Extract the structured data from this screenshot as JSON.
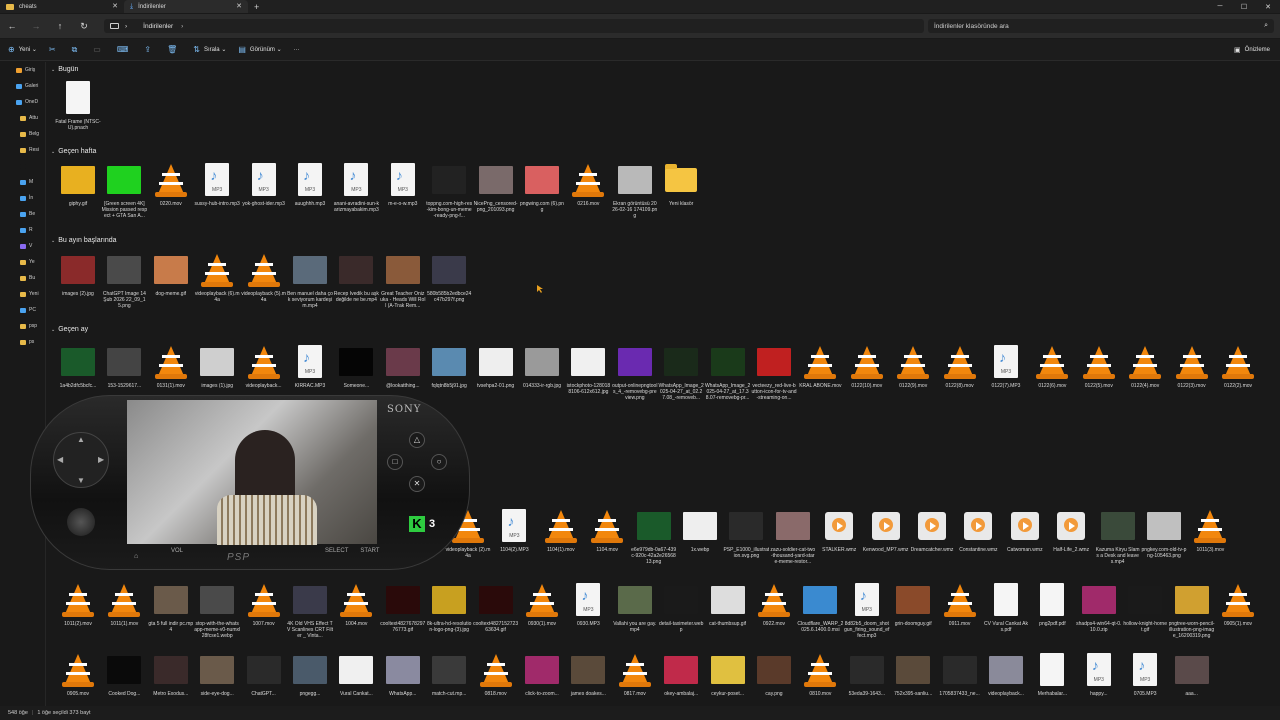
{
  "tabs": [
    {
      "label": "cheats",
      "active": false
    },
    {
      "label": "İndirilenler",
      "active": true
    }
  ],
  "address": {
    "path": [
      "İndirilenler"
    ],
    "search_placeholder": "İndirilenler klasöründe ara"
  },
  "commands": {
    "new": "Yeni",
    "sort": "Sırala",
    "view": "Görünüm",
    "more": "···",
    "preview": "Önizleme"
  },
  "sidebar": [
    {
      "label": "Giriş",
      "color": "#f0a030"
    },
    {
      "label": "Galeri",
      "color": "#4aa3f0"
    },
    {
      "label": "OneD",
      "color": "#4aa3f0"
    },
    {
      "label": "Attu",
      "color": "#e7b949"
    },
    {
      "label": "Belg",
      "color": "#e7b949"
    },
    {
      "label": "Resi",
      "color": "#e7b949"
    },
    {
      "label": "",
      "color": "#191919"
    },
    {
      "label": "M",
      "color": "#4aa3f0"
    },
    {
      "label": "İn",
      "color": "#4aa3f0"
    },
    {
      "label": "Be",
      "color": "#4aa3f0"
    },
    {
      "label": "R",
      "color": "#4aa3f0"
    },
    {
      "label": "V",
      "color": "#8a6af0"
    },
    {
      "label": "Ye",
      "color": "#e7b949"
    },
    {
      "label": "Bu",
      "color": "#e7b949"
    },
    {
      "label": "Yeni",
      "color": "#e7b949"
    },
    {
      "label": "PC",
      "color": "#4aa3f0"
    },
    {
      "label": "psp",
      "color": "#e7b949"
    },
    {
      "label": "ps",
      "color": "#e7b949"
    }
  ],
  "groups": {
    "today": "Bugün",
    "last_week": "Geçen hafta",
    "this_month": "Bu ayın başlarında",
    "last_month": "Geçen ay"
  },
  "rows": {
    "today": [
      {
        "name": "Fatal Frame (NTSC-U).pnach",
        "type": "blank"
      }
    ],
    "last_week": [
      {
        "name": "giphy.gif",
        "type": "thumb",
        "color": "#e8b020"
      },
      {
        "name": "[Green screen 4K] Mission passed respect + GTA San A...",
        "type": "thumb",
        "color": "#1fd11f"
      },
      {
        "name": "0220.mov",
        "type": "vlc"
      },
      {
        "name": "sussy-hub-intro.mp3",
        "type": "mp3"
      },
      {
        "name": "yok-ghost-ider.mp3",
        "type": "mp3"
      },
      {
        "name": "auughhh.mp3",
        "type": "mp3"
      },
      {
        "name": "anani-avradini-sun-karizmayabakim.mp3",
        "type": "mp3"
      },
      {
        "name": "m-e-o-w.mp3",
        "type": "mp3"
      },
      {
        "name": "toppng.com-high-res-kim-bong-un-meme-ready-png-f...",
        "type": "thumb",
        "color": "#222222"
      },
      {
        "name": "NicePng_censored-png_201093.png",
        "type": "thumb",
        "color": "#7a6a6a"
      },
      {
        "name": "pngwing.com (6).png",
        "type": "thumb",
        "color": "#d96060"
      },
      {
        "name": "0216.mov",
        "type": "vlc"
      },
      {
        "name": "Ekran görüntüsü 2026-02-16 174109.png",
        "type": "thumb",
        "color": "#b9b9b9"
      },
      {
        "name": "Yeni klasör",
        "type": "folder"
      }
    ],
    "this_month": [
      {
        "name": "images (2).jpg",
        "type": "thumb",
        "color": "#8a2a2a"
      },
      {
        "name": "ChatGPT Image 14 Şub 2026 22_09_15.png",
        "type": "thumb",
        "color": "#4a4a4a"
      },
      {
        "name": "dog-meme.gif",
        "type": "thumb",
        "color": "#c87b4a"
      },
      {
        "name": "videoplayback (6).m4a",
        "type": "vlc"
      },
      {
        "name": "videoplayback (5).m4a",
        "type": "vlc"
      },
      {
        "name": "Ben manuel daha çok seviyorum kardeşim.mp4",
        "type": "thumb",
        "color": "#5a6a7a"
      },
      {
        "name": "Recep İvedik bu aşk değilde ne be.mp4",
        "type": "thumb",
        "color": "#3a2a2a"
      },
      {
        "name": "Great Teacher Onizuka - Heads Will Roll (A-Trak Rem...",
        "type": "thumb",
        "color": "#8a5a3a"
      },
      {
        "name": "580b585b2edbce24c47b297f.png",
        "type": "thumb",
        "color": "#3a3a4a"
      }
    ],
    "last_month_1": [
      {
        "name": "1a4b2dfc5bcfc...",
        "type": "thumb",
        "color": "#1a5a2a"
      },
      {
        "name": "153-1529617...",
        "type": "thumb",
        "color": "#444444"
      },
      {
        "name": "0131(1).mov",
        "type": "vlc"
      },
      {
        "name": "images (1).jpg",
        "type": "thumb",
        "color": "#cfcfcf"
      },
      {
        "name": "videoplayback...",
        "type": "vlc"
      },
      {
        "name": "KIRRAC.MP3",
        "type": "mp3"
      },
      {
        "name": "Someone...",
        "type": "thumb",
        "color": "#050505"
      },
      {
        "name": "@lookatthing...",
        "type": "thumb",
        "color": "#6a3a4a"
      },
      {
        "name": "fqlqtn8b5j91.jpg",
        "type": "thumb",
        "color": "#5a8ab0"
      },
      {
        "name": "tvsehpa2-01.png",
        "type": "thumb",
        "color": "#eeeeee"
      },
      {
        "name": "014333-ir-rgb.jpg",
        "type": "thumb",
        "color": "#9a9a9a"
      },
      {
        "name": "istockphoto-1280188106-612x612.jpg",
        "type": "thumb",
        "color": "#f0f0f0"
      },
      {
        "name": "output-onlinepngtools_4_-removebg-preview.png",
        "type": "thumb",
        "color": "#6a2ab0"
      },
      {
        "name": "WhatsApp_Image_2025-04-27_at_02.27.08_-removeb...",
        "type": "thumb",
        "color": "#1a2a1a"
      },
      {
        "name": "WhatsApp_Image_2025-04-27_at_17.38.07-removebg-pr...",
        "type": "thumb",
        "color": "#1a3a1a"
      },
      {
        "name": "vecteezy_red-live-button-icon-for-tv-and-streaming-on...",
        "type": "thumb",
        "color": "#c02020"
      },
      {
        "name": "KRAL ABONE.mov",
        "type": "vlc"
      },
      {
        "name": "0122(10).mov",
        "type": "vlc"
      },
      {
        "name": "0122(9).mov",
        "type": "vlc"
      },
      {
        "name": "0122(8).mov",
        "type": "vlc"
      },
      {
        "name": "0122(7).MP3",
        "type": "mp3"
      },
      {
        "name": "0122(6).mov",
        "type": "vlc"
      },
      {
        "name": "0122(5).mov",
        "type": "vlc"
      },
      {
        "name": "0122(4).mov",
        "type": "vlc"
      },
      {
        "name": "0122(3).mov",
        "type": "vlc"
      },
      {
        "name": "0122(2).mov",
        "type": "vlc"
      }
    ],
    "last_month_2": [
      {
        "name": "videoplayback (2).m4a",
        "type": "vlc"
      },
      {
        "name": "1104(2).MP3",
        "type": "mp3"
      },
      {
        "name": "1104(1).mov",
        "type": "vlc"
      },
      {
        "name": "1104.mov",
        "type": "vlc"
      },
      {
        "name": "e6e979db-0a67-439c-920c-42a2e2656813.png",
        "type": "thumb",
        "color": "#1a5a2a"
      },
      {
        "name": "1x.webp",
        "type": "thumb",
        "color": "#eeeeee"
      },
      {
        "name": "PSP_E1000_illustration.svg.png",
        "type": "thumb",
        "color": "#2a2a2a"
      },
      {
        "name": "zazu-soldier-cat-two-thousand-yard-stare-meme-restor...",
        "type": "thumb",
        "color": "#8a6a6a"
      },
      {
        "name": "STALKER.wmz",
        "type": "wmv"
      },
      {
        "name": "Kenwood_MP7.wmz",
        "type": "wmv"
      },
      {
        "name": "Dreamcatcher.wmz",
        "type": "wmv"
      },
      {
        "name": "Constantine.wmz",
        "type": "wmv"
      },
      {
        "name": "Catwoman.wmz",
        "type": "wmv"
      },
      {
        "name": "Half-Life_2.wmz",
        "type": "wmv"
      },
      {
        "name": "Kazuma Kiryu Slams a Desk and leaves.mp4",
        "type": "thumb",
        "color": "#3a4a3a"
      },
      {
        "name": "pngkey.com-old-tv-png-105463.png",
        "type": "thumb",
        "color": "#c0c0c0"
      },
      {
        "name": "1011(3).mov",
        "type": "vlc"
      },
      {
        "name": "windows xp gangster edition but it's in 4K.mp4",
        "type": "thumb",
        "color": "#1a2a4a"
      }
    ],
    "last_month_3": [
      {
        "name": "1011(2).mov",
        "type": "vlc"
      },
      {
        "name": "1011(1).mov",
        "type": "vlc"
      },
      {
        "name": "gta 5 full indir pc.mp4",
        "type": "thumb",
        "color": "#6a5a4a"
      },
      {
        "name": "stop-with-the-whatsapp-meme-v0-numxl28fcse1.webp",
        "type": "thumb",
        "color": "#4a4a4a"
      },
      {
        "name": "1007.mov",
        "type": "vlc"
      },
      {
        "name": "4K Old VHS Effect TV Scanlines CRT Filter _ Vinta...",
        "type": "thumb",
        "color": "#3a3a4a"
      },
      {
        "name": "1004.mov",
        "type": "vlc"
      },
      {
        "name": "cooltext482767829776773.gif",
        "type": "thumb",
        "color": "#2a0a0a"
      },
      {
        "name": "8k-ultra-hd-resolution-logo-png-(3).jpg",
        "type": "thumb",
        "color": "#c8a020"
      },
      {
        "name": "cooltext482715272363634.gif",
        "type": "thumb",
        "color": "#2a0a0a"
      },
      {
        "name": "0930(1).mov",
        "type": "vlc"
      },
      {
        "name": "0930.MP3",
        "type": "mp3"
      },
      {
        "name": "Vallahi you are gay.mp4",
        "type": "thumb",
        "color": "#5a6a4a"
      },
      {
        "name": "detail-taximeter.webp",
        "type": "thumb",
        "color": "#1a1a1a"
      },
      {
        "name": "cat-thumbsup.gif",
        "type": "thumb",
        "color": "#dddddd"
      },
      {
        "name": "0922.mov",
        "type": "vlc"
      },
      {
        "name": "Cloudflare_WARP_2025.6.1400.0.msi",
        "type": "thumb",
        "color": "#3a8ad0"
      },
      {
        "name": "8d82b5_doom_shotgun_firing_sound_effect.mp3",
        "type": "mp3"
      },
      {
        "name": "grin-doomguy.gif",
        "type": "thumb",
        "color": "#8a4a2a"
      },
      {
        "name": "0911.mov",
        "type": "vlc"
      },
      {
        "name": "CV Vural Cankat Aks.pdf",
        "type": "blank"
      },
      {
        "name": "png2pdf.pdf",
        "type": "blank"
      },
      {
        "name": "shadps4-win64-qt-0.10.0.zip",
        "type": "thumb",
        "color": "#a02a6a"
      },
      {
        "name": "hollow-knight-hornet.gif",
        "type": "thumb",
        "color": "#1a1a1a"
      },
      {
        "name": "pngtree-worn-pencil-illustration-png-image_16200319.png",
        "type": "thumb",
        "color": "#d0a030"
      },
      {
        "name": "0905(1).mov",
        "type": "vlc"
      }
    ],
    "last_month_4": [
      {
        "name": "0905.mov",
        "type": "vlc"
      },
      {
        "name": "Cooked Dog...",
        "type": "thumb",
        "color": "#0a0a0a"
      },
      {
        "name": "Metro Exodus...",
        "type": "thumb",
        "color": "#3a2a2a"
      },
      {
        "name": "side-eye-dog...",
        "type": "thumb",
        "color": "#6a5a4a"
      },
      {
        "name": "ChatGPT...",
        "type": "thumb",
        "color": "#2a2a2a"
      },
      {
        "name": "pngegg...",
        "type": "thumb",
        "color": "#4a5a6a"
      },
      {
        "name": "Vural Cankat...",
        "type": "thumb",
        "color": "#f0f0f0"
      },
      {
        "name": "WhatsApp...",
        "type": "thumb",
        "color": "#8a8aa0"
      },
      {
        "name": "match-cut.mp...",
        "type": "thumb",
        "color": "#3a3a3a"
      },
      {
        "name": "0818.mov",
        "type": "vlc"
      },
      {
        "name": "click-to-zoom...",
        "type": "thumb",
        "color": "#a02a6a"
      },
      {
        "name": "james doakes...",
        "type": "thumb",
        "color": "#5a4a3a"
      },
      {
        "name": "0817.mov",
        "type": "vlc"
      },
      {
        "name": "okey-ambalaj...",
        "type": "thumb",
        "color": "#c02a4a"
      },
      {
        "name": "ceykur-poset...",
        "type": "thumb",
        "color": "#e0c040"
      },
      {
        "name": "cay.png",
        "type": "thumb",
        "color": "#5a3a2a"
      },
      {
        "name": "0810.mov",
        "type": "vlc"
      },
      {
        "name": "53eda39-1643...",
        "type": "thumb",
        "color": "#2a2a2a"
      },
      {
        "name": "752x395-sanliu...",
        "type": "thumb",
        "color": "#5a4a3a"
      },
      {
        "name": "1705837433_ne...",
        "type": "thumb",
        "color": "#2a2a2a"
      },
      {
        "name": "videoplayback...",
        "type": "thumb",
        "color": "#8a8a9a"
      },
      {
        "name": "Merhabalar...",
        "type": "blank"
      },
      {
        "name": "happy...",
        "type": "mp3"
      },
      {
        "name": "0705.MP3",
        "type": "mp3"
      },
      {
        "name": "aaa...",
        "type": "thumb",
        "color": "#5a4a4a"
      }
    ]
  },
  "psp": {
    "brand": "SONY",
    "logo": "PSP",
    "select": "SELECT",
    "start": "START",
    "vol": "VOL",
    "badge_letter": "K",
    "badge_number": "3"
  },
  "status": {
    "count": "548 öğe",
    "selection": "1 öğe seçildi  373 bayt"
  }
}
